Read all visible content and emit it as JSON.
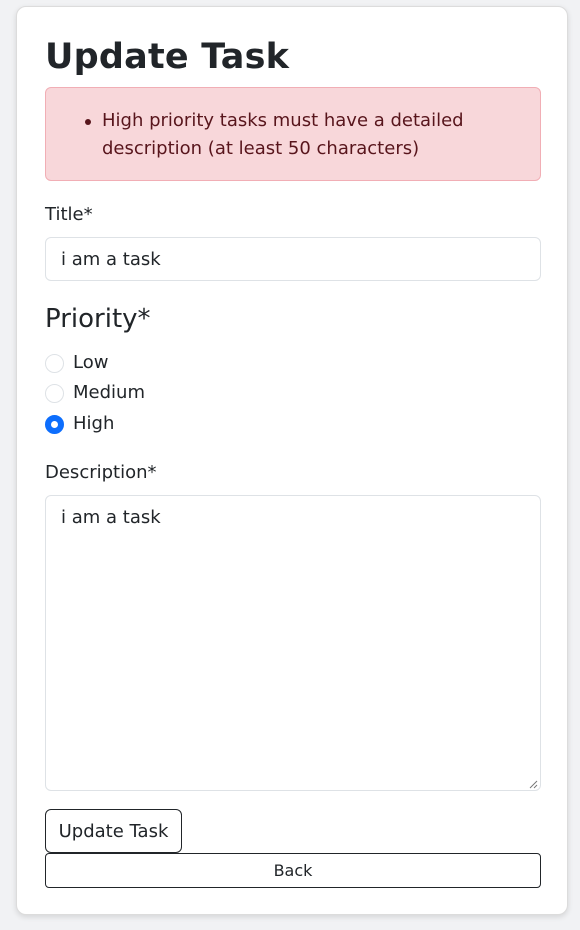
{
  "page": {
    "title": "Update Task"
  },
  "alert": {
    "errors": [
      "High priority tasks must have a detailed description (at least 50 characters)"
    ],
    "color_background": "#f8d7da",
    "color_text": "#58151c"
  },
  "form": {
    "title_label": "Title*",
    "title_value": "i am a task",
    "priority_heading": "Priority*",
    "priority_options": [
      {
        "label": "Low",
        "checked": false
      },
      {
        "label": "Medium",
        "checked": false
      },
      {
        "label": "High",
        "checked": true
      }
    ],
    "description_label": "Description*",
    "description_value": "i am a task"
  },
  "actions": {
    "update_label": "Update Task",
    "back_label": "Back"
  },
  "colors": {
    "accent": "#0d6efd"
  }
}
